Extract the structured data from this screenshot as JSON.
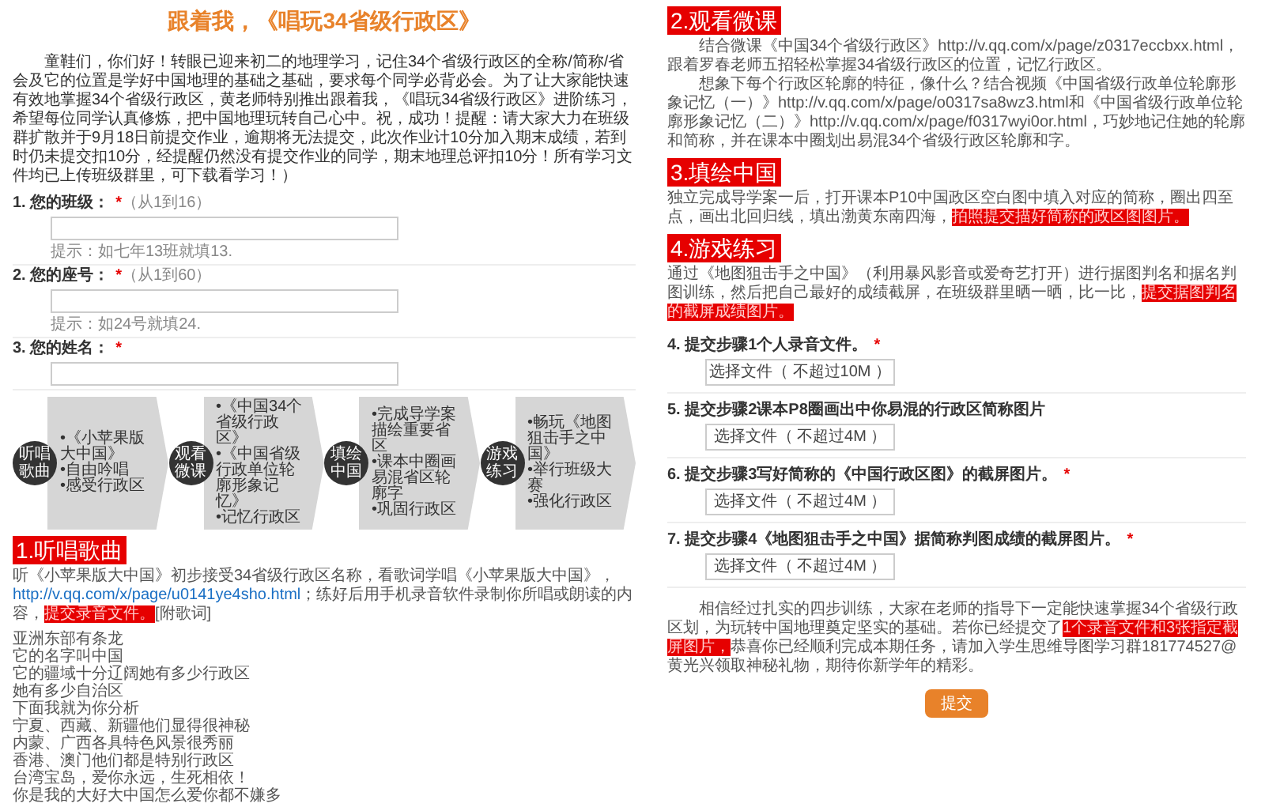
{
  "title": "跟着我，《唱玩34省级行政区》",
  "intro": "童鞋们，你们好！转眼已迎来初二的地理学习，记住34个省级行政区的全称/简称/省会及它的位置是学好中国地理的基础之基础，要求每个同学必背必会。为了让大家能快速有效地掌握34个省级行政区，黄老师特别推出跟着我，《唱玩34省级行政区》进阶练习，希望每位同学认真修炼，把中国地理玩转自己心中。祝，成功！提醒：请大家大力在班级群扩散并于9月18日前提交作业，逾期将无法提交，此次作业计10分加入期末成绩，若到时仍未提交扣10分，经提醒仍然没有提交作业的同学，期末地理总评扣10分！所有学习文件均已上传班级群里，可下载看学习！）",
  "questions": [
    {
      "number": "1.",
      "label": "您的班级：",
      "required": "*",
      "range": "（从1到16）",
      "hint": "提示：如七年13班就填13."
    },
    {
      "number": "2.",
      "label": "您的座号：",
      "required": "*",
      "range": "（从1到60）",
      "hint": "提示：如24号就填24."
    },
    {
      "number": "3.",
      "label": "您的姓名：",
      "required": "*"
    }
  ],
  "process_steps": [
    {
      "title_lines": [
        "听唱",
        "歌曲"
      ],
      "bullets": [
        "•《小苹果版大中国》",
        "•自由吟唱",
        "•感受行政区"
      ]
    },
    {
      "title_lines": [
        "观看",
        "微课"
      ],
      "bullets": [
        "•《中国34个省级行政区》",
        "•《中国省级行政单位轮廓形象记忆》",
        "•记忆行政区"
      ]
    },
    {
      "title_lines": [
        "填绘",
        "中国"
      ],
      "bullets": [
        "•完成导学案",
        "描绘重要省区",
        "•课本中圈画易混省区轮廓字",
        "•巩固行政区"
      ]
    },
    {
      "title_lines": [
        "游戏",
        "练习"
      ],
      "bullets": [
        "•畅玩《地图狙击手之中国》",
        "•举行班级大赛",
        "•强化行政区"
      ]
    }
  ],
  "section_1": {
    "heading": "1.听唱歌曲",
    "paragraph": [
      {
        "kind": "text",
        "text": "听《小苹果版大中国》初步接受34省级行政区名称，看歌词学唱《小苹果版大中国》，"
      },
      {
        "kind": "link",
        "text": "http://v.qq.com/x/page/u0141ye4sho.html"
      },
      {
        "kind": "text",
        "text": "；练好后用手机录音软件录制你所唱或朗读的内容，"
      },
      {
        "kind": "highlight",
        "text": "提交录音文件。"
      },
      {
        "kind": "text",
        "text": "[附歌词]"
      }
    ],
    "lyrics": [
      "亚洲东部有条龙",
      "它的名字叫中国",
      "它的疆域十分辽阔她有多少行政区",
      "她有多少自治区",
      "下面我就为你分析",
      "宁夏、西藏、新疆他们显得很神秘",
      "内蒙、广西各具特色风景很秀丽",
      "香港、澳门他们都是特别行政区",
      "台湾宝岛，爱你永远，生死相依！",
      "你是我的大好大中国怎么爱你都不嫌多"
    ]
  },
  "sections": [
    {
      "heading": "2.观看微课",
      "paragraphs": [
        [
          {
            "kind": "text",
            "text": "结合微课《中国34个省级行政区》http://v.qq.com/x/page/z0317eccbxx.html，跟着罗春老师五招轻松掌握34省级行政区的位置，记忆行政区。"
          }
        ],
        [
          {
            "kind": "text",
            "text": "想象下每个行政区轮廓的特征，像什么？结合视频《中国省级行政单位轮廓形象记忆（一）》http://v.qq.com/x/page/o0317sa8wz3.html和《中国省级行政单位轮廓形象记忆（二）》http://v.qq.com/x/page/f0317wyi0or.html，巧妙地记住她的轮廓和简称，并在课本中圈划出易混34个省级行政区轮廓和字。"
          }
        ]
      ]
    },
    {
      "heading": "3.填绘中国",
      "paragraphs": [
        [
          {
            "kind": "text",
            "text": "独立完成导学案一后，打开课本P10中国政区空白图中填入对应的简称，圈出四至点，画出北回归线，填出渤黄东南四海，"
          },
          {
            "kind": "highlight",
            "text": "拍照提交描好简称的政区图图片。"
          }
        ]
      ]
    },
    {
      "heading": "4.游戏练习",
      "paragraphs": [
        [
          {
            "kind": "text",
            "text": "通过《地图狙击手之中国》（利用暴风影音或爱奇艺打开）进行据图判名和据名判图训练，然后把自己最好的成绩截屏，在班级群里晒一晒，比一比，"
          },
          {
            "kind": "highlight",
            "text": "提交据图判名的截屏成绩图片。"
          }
        ]
      ]
    }
  ],
  "uploads": [
    {
      "number": "4.",
      "label": "提交步骤1个人录音文件。",
      "required": "*",
      "button": "选择文件（ 不超过10M ）"
    },
    {
      "number": "5.",
      "label": "提交步骤2课本P8圈画出中你易混的行政区简称图片",
      "button": "选择文件（ 不超过4M ）"
    },
    {
      "number": "6.",
      "label": "提交步骤3写好简称的《中国行政区图》的截屏图片。",
      "required": "*",
      "button": "选择文件（ 不超过4M ）"
    },
    {
      "number": "7.",
      "label": "提交步骤4《地图狙击手之中国》据简称判图成绩的截屏图片。",
      "required": "*",
      "button": "选择文件（ 不超过4M ）"
    }
  ],
  "closing": [
    {
      "kind": "text",
      "text": "相信经过扎实的四步训练，大家在老师的指导下一定能快速掌握34个省级行政区划，为玩转中国地理奠定坚实的基础。若你已经提交了"
    },
    {
      "kind": "highlight",
      "text": "1个录音文件和3张指定截屏图片，"
    },
    {
      "kind": "text",
      "text": "恭喜你已经顺利完成本期任务，请加入学生思维导图学习群181774527@黄光兴领取神秘礼物，期待你新学年的精彩。"
    }
  ],
  "submit": "提交"
}
